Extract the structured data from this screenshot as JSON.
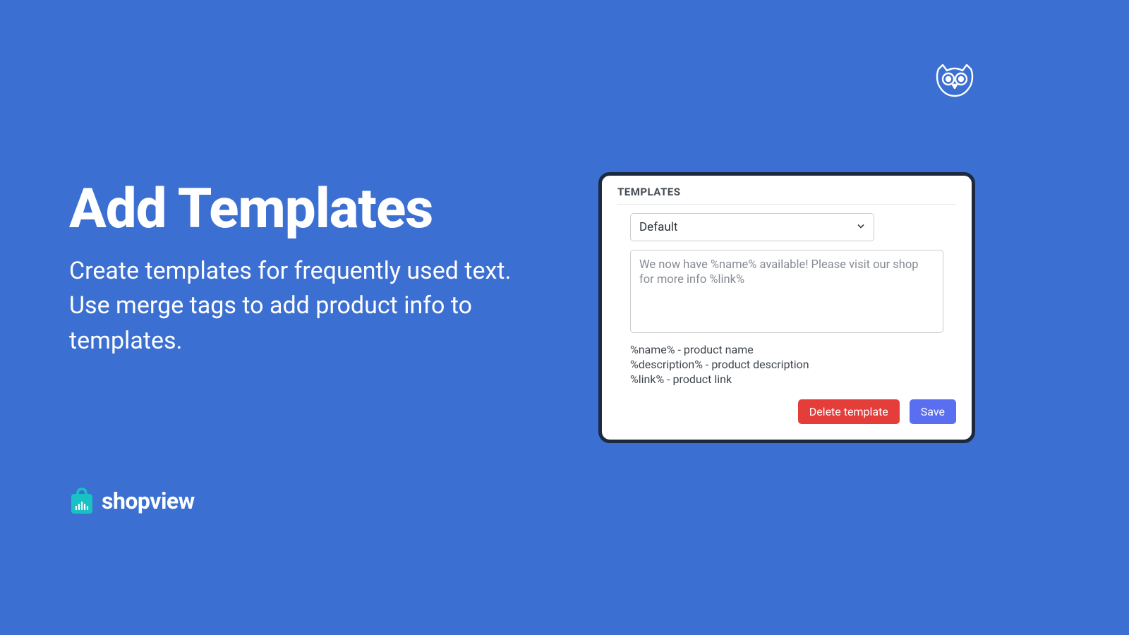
{
  "hero": {
    "title": "Add Templates",
    "subtitle": "Create templates for frequently used text. Use merge tags to add product info to templates."
  },
  "logo": {
    "name": "shopview"
  },
  "panel": {
    "header": "TEMPLATES",
    "selected_option": "Default",
    "textarea_value": "We now have %name% available! Please visit our shop for more info %link%",
    "hints": [
      "%name% - product name",
      "%description% - product description",
      "%link% - product link"
    ],
    "delete_label": "Delete template",
    "save_label": "Save"
  },
  "colors": {
    "background": "#3b6fd1",
    "panel_border": "#1d293f",
    "danger": "#e43d3a",
    "primary": "#5a6ff0",
    "logo_accent": "#18c1c4"
  }
}
